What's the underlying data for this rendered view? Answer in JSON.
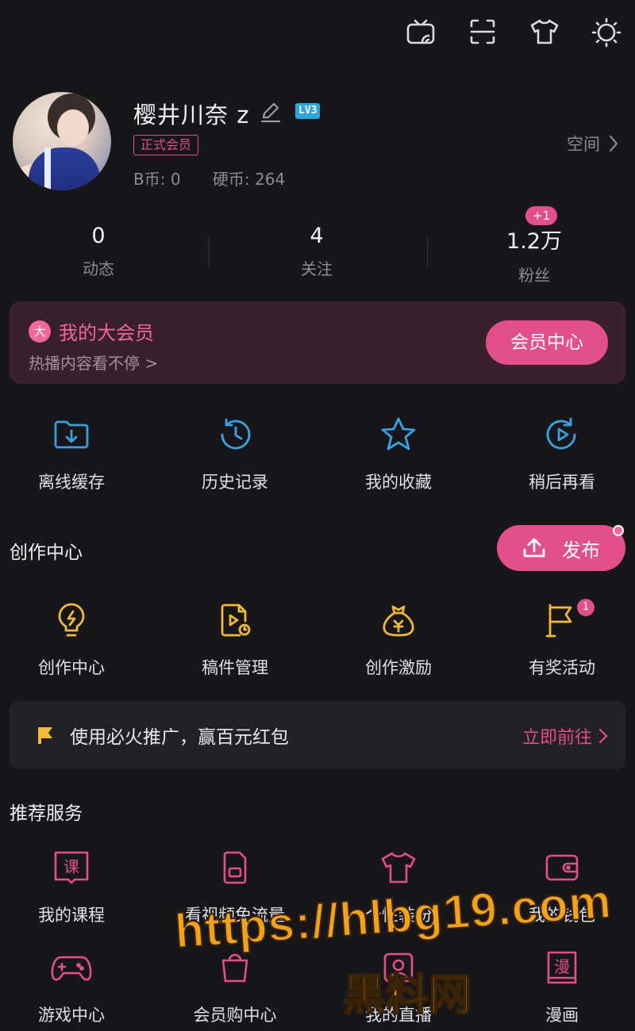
{
  "top_bar": {
    "icons": [
      "tv-cast-icon",
      "scan-icon",
      "tshirt-icon",
      "theme-icon"
    ]
  },
  "profile": {
    "username": "樱井川奈 z",
    "level": "LV3",
    "vip_badge": "正式会员",
    "b_coins": "B币: 0",
    "hard_coins": "硬币: 264",
    "space_link": "空间"
  },
  "stats": [
    {
      "value": "0",
      "label": "动态"
    },
    {
      "value": "4",
      "label": "关注"
    },
    {
      "value": "1.2万",
      "label": "粉丝",
      "badge": "+1"
    }
  ],
  "vip_card": {
    "icon_char": "大",
    "title": "我的大会员",
    "subtitle": "热播内容看不停 >",
    "button": "会员中心"
  },
  "quick_actions": [
    {
      "label": "离线缓存",
      "icon": "download-folder-icon"
    },
    {
      "label": "历史记录",
      "icon": "history-clock-icon"
    },
    {
      "label": "我的收藏",
      "icon": "star-icon"
    },
    {
      "label": "稍后再看",
      "icon": "watch-later-icon"
    }
  ],
  "creation": {
    "title": "创作中心",
    "publish_button": "发布",
    "items": [
      {
        "label": "创作中心",
        "icon": "lightbulb-icon"
      },
      {
        "label": "稿件管理",
        "icon": "manuscript-icon"
      },
      {
        "label": "创作激励",
        "icon": "money-bag-icon"
      },
      {
        "label": "有奖活动",
        "icon": "flag-icon",
        "badge": "1"
      }
    ]
  },
  "promo": {
    "text": "使用必火推广，赢百元红包",
    "link": "立即前往"
  },
  "services": {
    "title": "推荐服务",
    "row1": [
      {
        "label": "我的课程",
        "icon": "course-book-icon",
        "glyph": "课"
      },
      {
        "label": "看视频免流量",
        "icon": "sim-card-icon"
      },
      {
        "label": "个性装扮",
        "icon": "tshirt-icon"
      },
      {
        "label": "我的钱包",
        "icon": "wallet-icon"
      }
    ],
    "row2": [
      {
        "label": "游戏中心",
        "icon": "gamepad-icon"
      },
      {
        "label": "会员购中心",
        "icon": "shopping-icon"
      },
      {
        "label": "我的直播",
        "icon": "live-icon"
      },
      {
        "label": "漫画",
        "icon": "comic-icon",
        "glyph": "漫"
      }
    ]
  },
  "watermark": {
    "url": "https://hlbg19.com",
    "name": "黑料网"
  },
  "colors": {
    "accent_pink": "#e24f8a",
    "accent_blue": "#3aa0e4",
    "accent_yellow": "#f1b93a",
    "background": "#17171a"
  }
}
